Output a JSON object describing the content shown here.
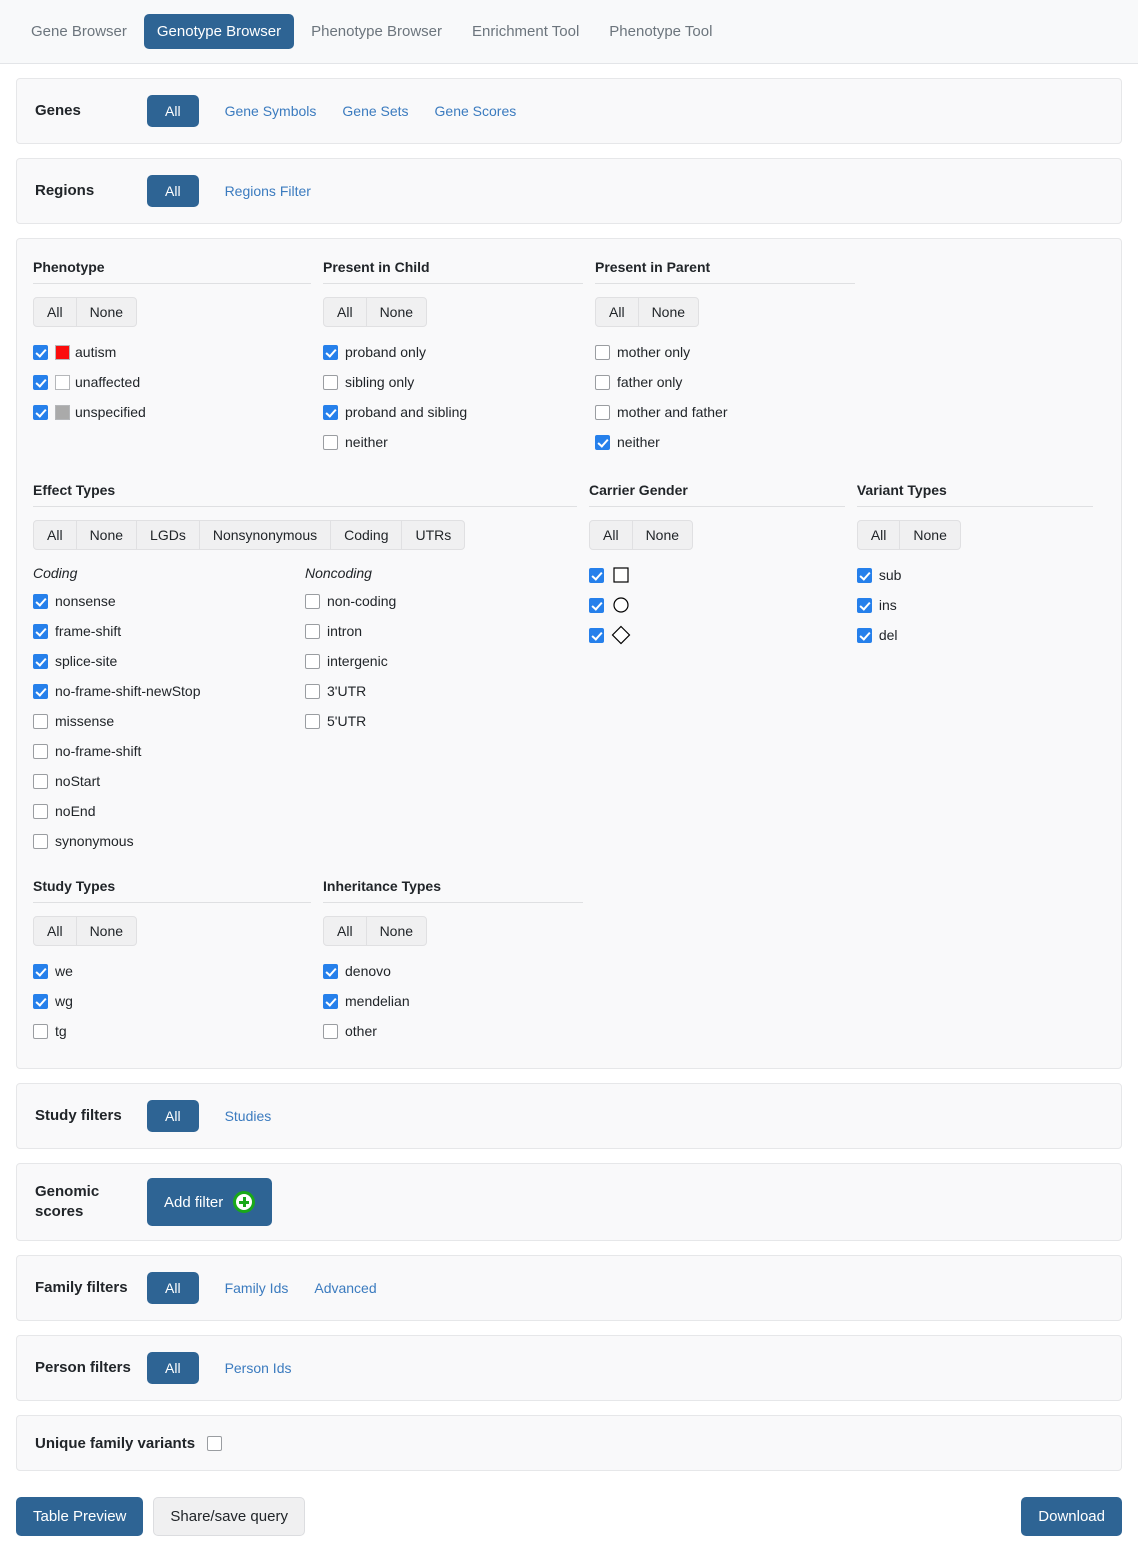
{
  "tabs": [
    {
      "label": "Gene Browser",
      "active": false
    },
    {
      "label": "Genotype Browser",
      "active": true
    },
    {
      "label": "Phenotype Browser",
      "active": false
    },
    {
      "label": "Enrichment Tool",
      "active": false
    },
    {
      "label": "Phenotype Tool",
      "active": false
    }
  ],
  "genes": {
    "label": "Genes",
    "all_button": "All",
    "links": [
      "Gene Symbols",
      "Gene Sets",
      "Gene Scores"
    ]
  },
  "regions": {
    "label": "Regions",
    "all_button": "All",
    "links": [
      "Regions Filter"
    ]
  },
  "phenotype": {
    "title": "Phenotype",
    "buttons": [
      "All",
      "None"
    ],
    "items": [
      {
        "label": "autism",
        "checked": true,
        "color": "#fb0c0c"
      },
      {
        "label": "unaffected",
        "checked": true,
        "color": "#ffffff"
      },
      {
        "label": "unspecified",
        "checked": true,
        "color": "#aaaaaa"
      }
    ]
  },
  "present_in_child": {
    "title": "Present in Child",
    "buttons": [
      "All",
      "None"
    ],
    "items": [
      {
        "label": "proband only",
        "checked": true
      },
      {
        "label": "sibling only",
        "checked": false
      },
      {
        "label": "proband and sibling",
        "checked": true
      },
      {
        "label": "neither",
        "checked": false
      }
    ]
  },
  "present_in_parent": {
    "title": "Present in Parent",
    "buttons": [
      "All",
      "None"
    ],
    "items": [
      {
        "label": "mother only",
        "checked": false
      },
      {
        "label": "father only",
        "checked": false
      },
      {
        "label": "mother and father",
        "checked": false
      },
      {
        "label": "neither",
        "checked": true
      }
    ]
  },
  "effect_types": {
    "title": "Effect Types",
    "buttons": [
      "All",
      "None",
      "LGDs",
      "Nonsynonymous",
      "Coding",
      "UTRs"
    ],
    "coding_header": "Coding",
    "noncoding_header": "Noncoding",
    "coding": [
      {
        "label": "nonsense",
        "checked": true
      },
      {
        "label": "frame-shift",
        "checked": true
      },
      {
        "label": "splice-site",
        "checked": true
      },
      {
        "label": "no-frame-shift-newStop",
        "checked": true
      },
      {
        "label": "missense",
        "checked": false
      },
      {
        "label": "no-frame-shift",
        "checked": false
      },
      {
        "label": "noStart",
        "checked": false
      },
      {
        "label": "noEnd",
        "checked": false
      },
      {
        "label": "synonymous",
        "checked": false
      }
    ],
    "noncoding": [
      {
        "label": "non-coding",
        "checked": false
      },
      {
        "label": "intron",
        "checked": false
      },
      {
        "label": "intergenic",
        "checked": false
      },
      {
        "label": "3'UTR",
        "checked": false
      },
      {
        "label": "5'UTR",
        "checked": false
      }
    ]
  },
  "carrier_gender": {
    "title": "Carrier Gender",
    "buttons": [
      "All",
      "None"
    ],
    "items": [
      {
        "shape": "square",
        "checked": true
      },
      {
        "shape": "circle",
        "checked": true
      },
      {
        "shape": "diamond",
        "checked": true
      }
    ]
  },
  "variant_types": {
    "title": "Variant Types",
    "buttons": [
      "All",
      "None"
    ],
    "items": [
      {
        "label": "sub",
        "checked": true
      },
      {
        "label": "ins",
        "checked": true
      },
      {
        "label": "del",
        "checked": true
      }
    ]
  },
  "study_types": {
    "title": "Study Types",
    "buttons": [
      "All",
      "None"
    ],
    "items": [
      {
        "label": "we",
        "checked": true
      },
      {
        "label": "wg",
        "checked": true
      },
      {
        "label": "tg",
        "checked": false
      }
    ]
  },
  "inheritance_types": {
    "title": "Inheritance Types",
    "buttons": [
      "All",
      "None"
    ],
    "items": [
      {
        "label": "denovo",
        "checked": true
      },
      {
        "label": "mendelian",
        "checked": true
      },
      {
        "label": "other",
        "checked": false
      }
    ]
  },
  "study_filters": {
    "label": "Study filters",
    "all_button": "All",
    "links": [
      "Studies"
    ]
  },
  "genomic_scores": {
    "label": "Genomic scores",
    "add_filter_label": "Add filter"
  },
  "family_filters": {
    "label": "Family filters",
    "all_button": "All",
    "links": [
      "Family Ids",
      "Advanced"
    ]
  },
  "person_filters": {
    "label": "Person filters",
    "all_button": "All",
    "links": [
      "Person Ids"
    ]
  },
  "unique_family_variants": {
    "label": "Unique family variants",
    "checked": false
  },
  "footer": {
    "table_preview": "Table Preview",
    "share_save": "Share/save query",
    "download": "Download"
  },
  "colors": {
    "primary": "#2e6494",
    "link": "#3b7bbf",
    "checkbox": "#2680eb",
    "plus_green": "#19a819",
    "panel_bg": "#f9f9fa"
  }
}
